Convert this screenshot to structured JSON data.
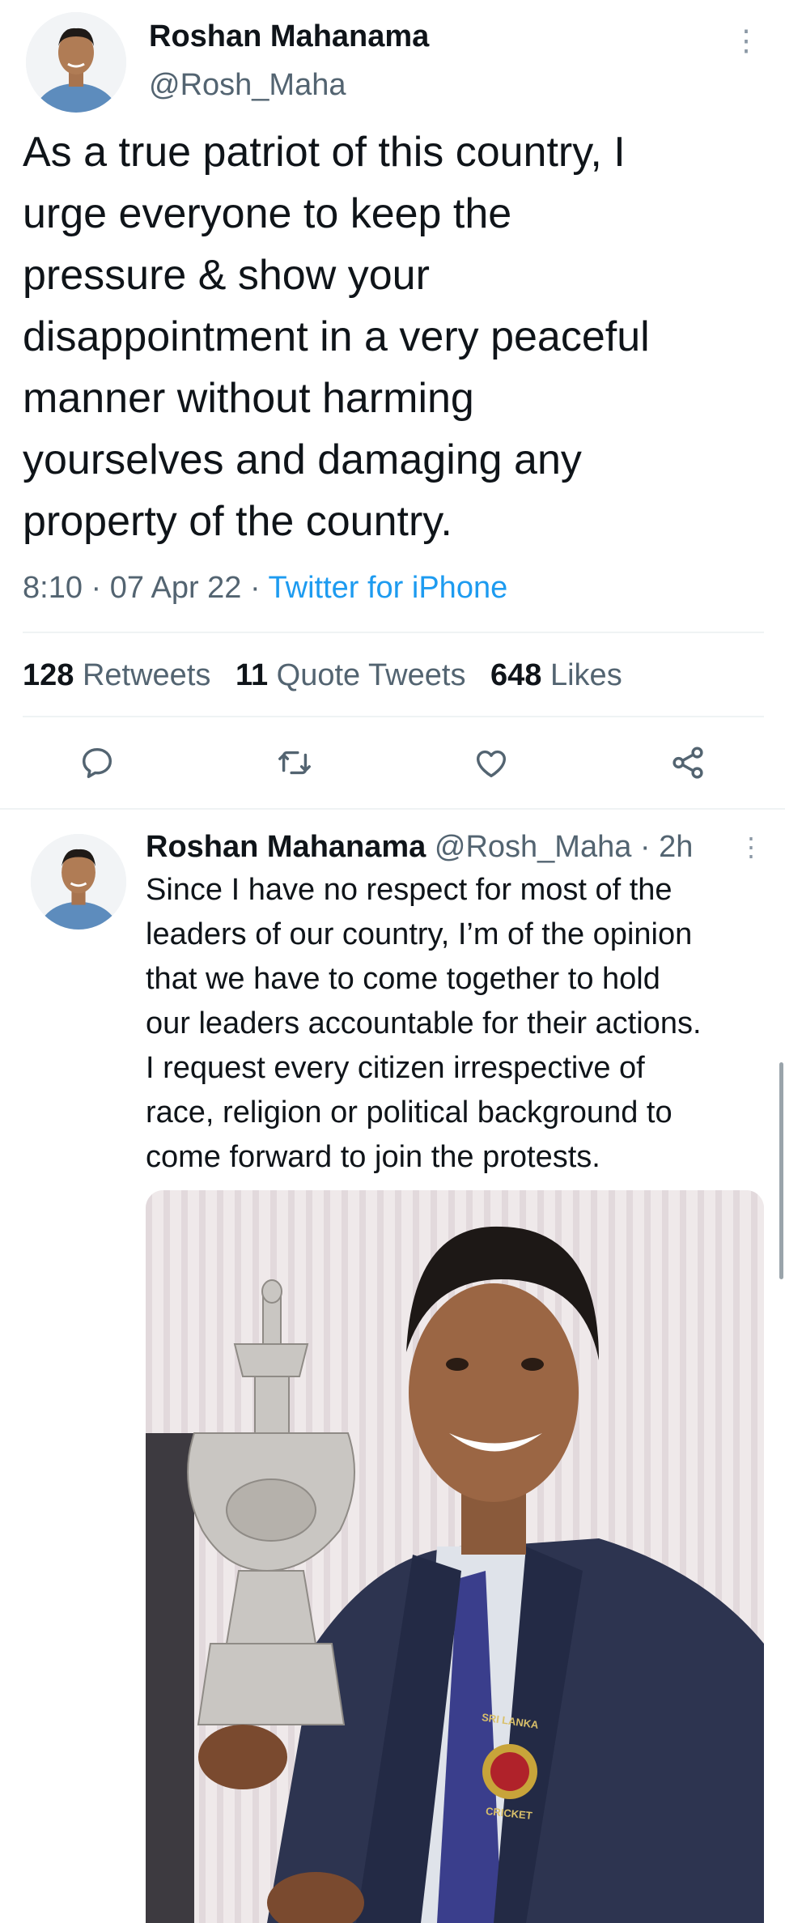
{
  "main_tweet": {
    "author_name": "Roshan Mahanama",
    "author_handle": "@Rosh_Maha",
    "text_lines": [
      "As a true patriot of this country, I",
      "urge everyone to keep the",
      "pressure & show your",
      "disappointment in a very peaceful",
      "manner without harming",
      "yourselves and damaging any",
      "property of the country."
    ],
    "time": "8:10",
    "date": "07 Apr 22",
    "separator": "·",
    "source": "Twitter for iPhone",
    "stats": {
      "retweets_count": "128",
      "retweets_label": "Retweets",
      "quotes_count": "11",
      "quotes_label": "Quote Tweets",
      "likes_count": "648",
      "likes_label": "Likes"
    },
    "actions": [
      "reply-icon",
      "retweet-icon",
      "like-icon",
      "share-icon"
    ],
    "more_icon": "⋮"
  },
  "reply_tweet": {
    "author_name": "Roshan Mahanama",
    "author_handle": "@Rosh_Maha",
    "time_ago": "2h",
    "separator": "·",
    "more_icon": "⋮",
    "text_lines": [
      "Since I have no respect for most of the",
      "leaders of our country, I’m of the opinion",
      "that we have to come together to hold",
      "our leaders accountable for their actions.",
      "I request every citizen irrespective of",
      "race, religion or political background to",
      "come forward to join the protests."
    ],
    "media": {
      "badge_top": "SRI LANKA",
      "badge_bottom": "CRICKET"
    }
  },
  "colors": {
    "accent": "#1d9bf0",
    "text": "#0f1419",
    "muted": "#536471",
    "divider": "#eff3f4"
  }
}
